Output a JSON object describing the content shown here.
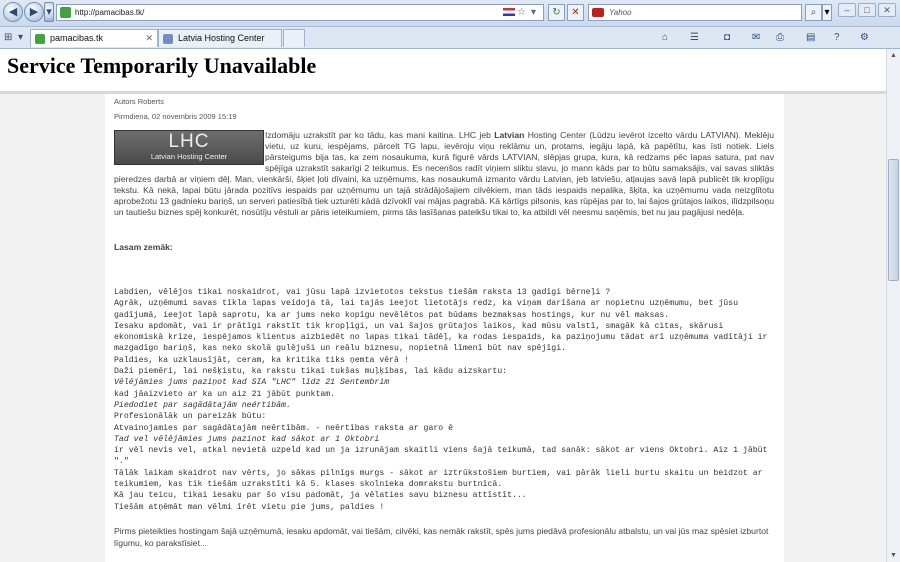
{
  "browser": {
    "url": "http://pamacibas.tk/",
    "search_placeholder": "Yahoo",
    "tabs": [
      {
        "label": "pamacibas.tk",
        "close": "✕"
      },
      {
        "label": "Latvia Hosting Center",
        "close": ""
      }
    ]
  },
  "page": {
    "error_title": "Service Temporarily Unavailable",
    "author": "Autors Roberts",
    "date": "Pirmdiena, 02 novembris 2009 15:19",
    "logo_big": "LHC",
    "logo_small": "Latvian Hosting Center",
    "intro_a": "Izdomāju uzrakstīt par ko tādu, kas mani kaitina. LHC jeb ",
    "intro_b": "Latvian",
    "intro_c": " Hosting Center (Lūdzu ievērot izcelto vārdu LATVIAN). Meklēju vietu, uz kuru, iespējams, pārcelt TG lapu, ievēroju viņu reklāmu un, protams, iegāju lapā, kā papētītu, kas īsti notiek. Liels pārsteigums bija tas, ka zem nosaukuma, kurā figurē vārds LATVIAN, slēpjas grupa, kura, kā redzams pēc lapas satura, pat nav spējīga uzrakstīt sakarīgi 2 teikumus. Es necenšos radīt viņiem sliktu slavu, jo mann kāds par to būtu samaksājis, vai savas sliktās pieredzes darbā ar viņiem dēļ. Man, vienkārši, šķiet ļoti dīvaini, ka uzņēmums, kas nosaukumā izmanto vārdu Latvian, jeb latviešu, atļaujas savā lapā publicēt tik kropļīgu tekstu. Kā nekā, lapai būtu jārada pozitīvs iespaids par uzņēmumu un tajā strādājošajiem cilvēkiem, man tāds iespaids nepalika, šķita, ka uzņēmumu vada neizglītotu aprobežotu 13 gadnieku bariņš, un serveri patiesībā tiek uzturēti kādā dzīvoklī vai mājas pagrabā. Kā kārtīgs pilsonis, kas rūpējas par to, lai šajos grūtajos laikos, ilīdzpilsoņu un tautiešu biznes spēj konkurēt, nosūtīju vēstuli ar pāris ieteikumiem, pirms tās lasīšanas pateikšu tikai to, ka atbildi vēl neesmu saņēmis, bet nu jau pagājusi nedēļa.",
    "lasam": "Lasam zemāk:",
    "letter": [
      {
        "text": "Labdien, vēlējos tikai noskaidrot, vai jūsu lapā izvietotos tekstus tiešām raksta 13 gadīgi bērneļi ?",
        "style": "normal"
      },
      {
        "text": "Agrāk, uzņēmumi savas tīkla lapas veidoja tā, lai tajās ieejot lietotājs redz, ka viņam darīšana ar nopietnu uzņēmumu, bet jūsu gadījumā, ieejot lapā saprotu, ka ar jums neko kopīgu nevēlētos pat būdams bezmaksas hostings, kur nu vēl maksas.",
        "style": "normal"
      },
      {
        "text": "Iesaku apdomāt, vai ir prātīgi rakstīt tik kropļīgi, un vai šajos grūtajos laikos, kad mūsu valstī, smagāk kā citas, skārusi ekonomiskā krīze, iespējamos klientus aizbiedēt no lapas tikai tādēļ, ka rodas iespaids, ka paziņojumu tādat arī uzņēmuma vadītāji ir mazgadīgo bariņš, kas neko skolā gulējuši un reālu biznesu, nopietnā līmenī būt nav spējīgi.",
        "style": "normal"
      },
      {
        "text": "Paldies, ka uzklausījāt, ceram, ka kritika tiks ņemta vērā !",
        "style": "normal"
      },
      {
        "text": "Daži piemēri, lai nešķistu, ka rakstu tikai tukšas muļķības, lai kādu aizskartu:",
        "style": "normal"
      },
      {
        "text": "Vēlējāmies jums paziņot kad SIA \"LHC\" līdz 21 Sentembrim",
        "style": "italic"
      },
      {
        "text": "kad jāaizvieto ar ka un aiz 21 jābūt punktam.",
        "style": "normal"
      },
      {
        "text": "Piedodiet par sagādātajām neértibām.",
        "style": "italic"
      },
      {
        "text": "Profesionālāk un pareizāk būtu:",
        "style": "normal"
      },
      {
        "text": "Atvainojamies par sagādātajām neērtībām. - neērtības raksta ar garo ē",
        "style": "normal"
      },
      {
        "text": "Tad vel vēlējāmies jums pazinot kad sākot ar 1 Oktobri",
        "style": "italic"
      },
      {
        "text": "ir vēl nevis vel, atkal nevietā uzpeld kad un ja izrunājam skaitli viens šajā teikumā, tad sanāk: sākot ar viens Oktobri. Aiz 1 jābūt \".\"",
        "style": "normal"
      },
      {
        "text": "Tālāk laikam skaidrot nav vērts, jo sākas pilnīgs murgs - sākot ar iztrūkstošiem burtiem, vai pārāk lieli burtu skaitu un beidzot ar teikumiem, kas tik tiešām uzrakstīti kā 5. klases skolnieka domrakstu burtnīcā.",
        "style": "normal"
      },
      {
        "text": "Kā jau teicu, tikai iesaku par šo visu padomāt, ja vēlaties savu biznesu attīstīt...",
        "style": "normal"
      },
      {
        "text": "Tiešām atņēmāt man vēlmi īrēt vietu pie jums, paldies !",
        "style": "normal"
      }
    ],
    "closing": "Pirms pieteikties hostingam šajā uzņēmumā, iesaku apdomāt, vai tiešām, cilvēki, kas nemāk rakstīt, spēs jums piedāvā profesionālu atbalstu, un vai jūs maz spēsiet izburtot līgumu, ko parakstīsiet..."
  },
  "colors": {
    "chrome": "#c9d9ee",
    "gutter": "#f2f2f2",
    "favicon": "#3fa33f"
  }
}
